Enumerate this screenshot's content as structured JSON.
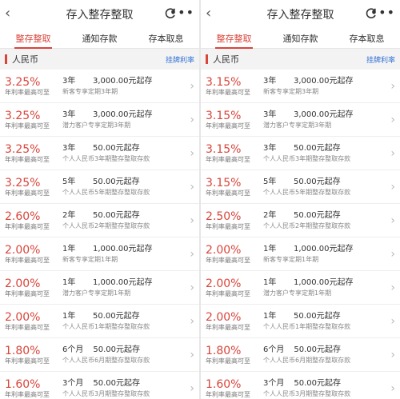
{
  "panels": [
    {
      "title": "存入整存整取",
      "tabs": [
        "整存整取",
        "通知存款",
        "存本取息"
      ],
      "section": {
        "title": "人民币",
        "link": "挂牌利率"
      },
      "rows": [
        {
          "rate": "3.25%",
          "rate_label": "年利率最高可至",
          "term": "3年",
          "amount": "3,000.00元起存",
          "desc": "新客专享定期3年期"
        },
        {
          "rate": "3.25%",
          "rate_label": "年利率最高可至",
          "term": "3年",
          "amount": "3,000.00元起存",
          "desc": "潜力客户专享定期3年期"
        },
        {
          "rate": "3.25%",
          "rate_label": "年利率最高可至",
          "term": "3年",
          "amount": "50.00元起存",
          "desc": "个人人民币3年期整存整取存款"
        },
        {
          "rate": "3.25%",
          "rate_label": "年利率最高可至",
          "term": "5年",
          "amount": "50.00元起存",
          "desc": "个人人民币5年期整存整取存款"
        },
        {
          "rate": "2.60%",
          "rate_label": "年利率最高可至",
          "term": "2年",
          "amount": "50.00元起存",
          "desc": "个人人民币2年期整存整取存款"
        },
        {
          "rate": "2.00%",
          "rate_label": "年利率最高可至",
          "term": "1年",
          "amount": "1,000.00元起存",
          "desc": "新客专享定期1年期"
        },
        {
          "rate": "2.00%",
          "rate_label": "年利率最高可至",
          "term": "1年",
          "amount": "1,000.00元起存",
          "desc": "潜力客户专享定期1年期"
        },
        {
          "rate": "2.00%",
          "rate_label": "年利率最高可至",
          "term": "1年",
          "amount": "50.00元起存",
          "desc": "个人人民币1年期整存整取存款"
        },
        {
          "rate": "1.80%",
          "rate_label": "年利率最高可至",
          "term": "6个月",
          "amount": "50.00元起存",
          "desc": "个人人民币6月期整存整取存款"
        },
        {
          "rate": "1.60%",
          "rate_label": "年利率最高可至",
          "term": "3个月",
          "amount": "50.00元起存",
          "desc": "个人人民币3月期整存整取存款"
        }
      ]
    },
    {
      "title": "存入整存整取",
      "tabs": [
        "整存整取",
        "通知存款",
        "存本取息"
      ],
      "section": {
        "title": "人民币",
        "link": "挂牌利率"
      },
      "rows": [
        {
          "rate": "3.15%",
          "rate_label": "年利率最高可至",
          "term": "3年",
          "amount": "3,000.00元起存",
          "desc": "新客专享定期3年期"
        },
        {
          "rate": "3.15%",
          "rate_label": "年利率最高可至",
          "term": "3年",
          "amount": "3,000.00元起存",
          "desc": "潜力客户专享定期3年期"
        },
        {
          "rate": "3.15%",
          "rate_label": "年利率最高可至",
          "term": "3年",
          "amount": "50.00元起存",
          "desc": "个人人民币3年期整存整取存款"
        },
        {
          "rate": "3.15%",
          "rate_label": "年利率最高可至",
          "term": "5年",
          "amount": "50.00元起存",
          "desc": "个人人民币5年期整存整取存款"
        },
        {
          "rate": "2.50%",
          "rate_label": "年利率最高可至",
          "term": "2年",
          "amount": "50.00元起存",
          "desc": "个人人民币2年期整存整取存款"
        },
        {
          "rate": "2.00%",
          "rate_label": "年利率最高可至",
          "term": "1年",
          "amount": "1,000.00元起存",
          "desc": "新客专享定期1年期"
        },
        {
          "rate": "2.00%",
          "rate_label": "年利率最高可至",
          "term": "1年",
          "amount": "1,000.00元起存",
          "desc": "潜力客户专享定期1年期"
        },
        {
          "rate": "2.00%",
          "rate_label": "年利率最高可至",
          "term": "1年",
          "amount": "50.00元起存",
          "desc": "个人人民币1年期整存整取存款"
        },
        {
          "rate": "1.80%",
          "rate_label": "年利率最高可至",
          "term": "6个月",
          "amount": "50.00元起存",
          "desc": "个人人民币6月期整存整取存款"
        },
        {
          "rate": "1.60%",
          "rate_label": "年利率最高可至",
          "term": "3个月",
          "amount": "50.00元起存",
          "desc": "个人人民币3月期整存整取存款"
        }
      ]
    }
  ],
  "icons": {
    "back": "chevron-left-icon",
    "refresh": "refresh-icon",
    "more": "more-dots-icon",
    "row": "chevron-right-icon"
  },
  "colors": {
    "accent": "#d9453b",
    "link": "#2f6fd6"
  }
}
